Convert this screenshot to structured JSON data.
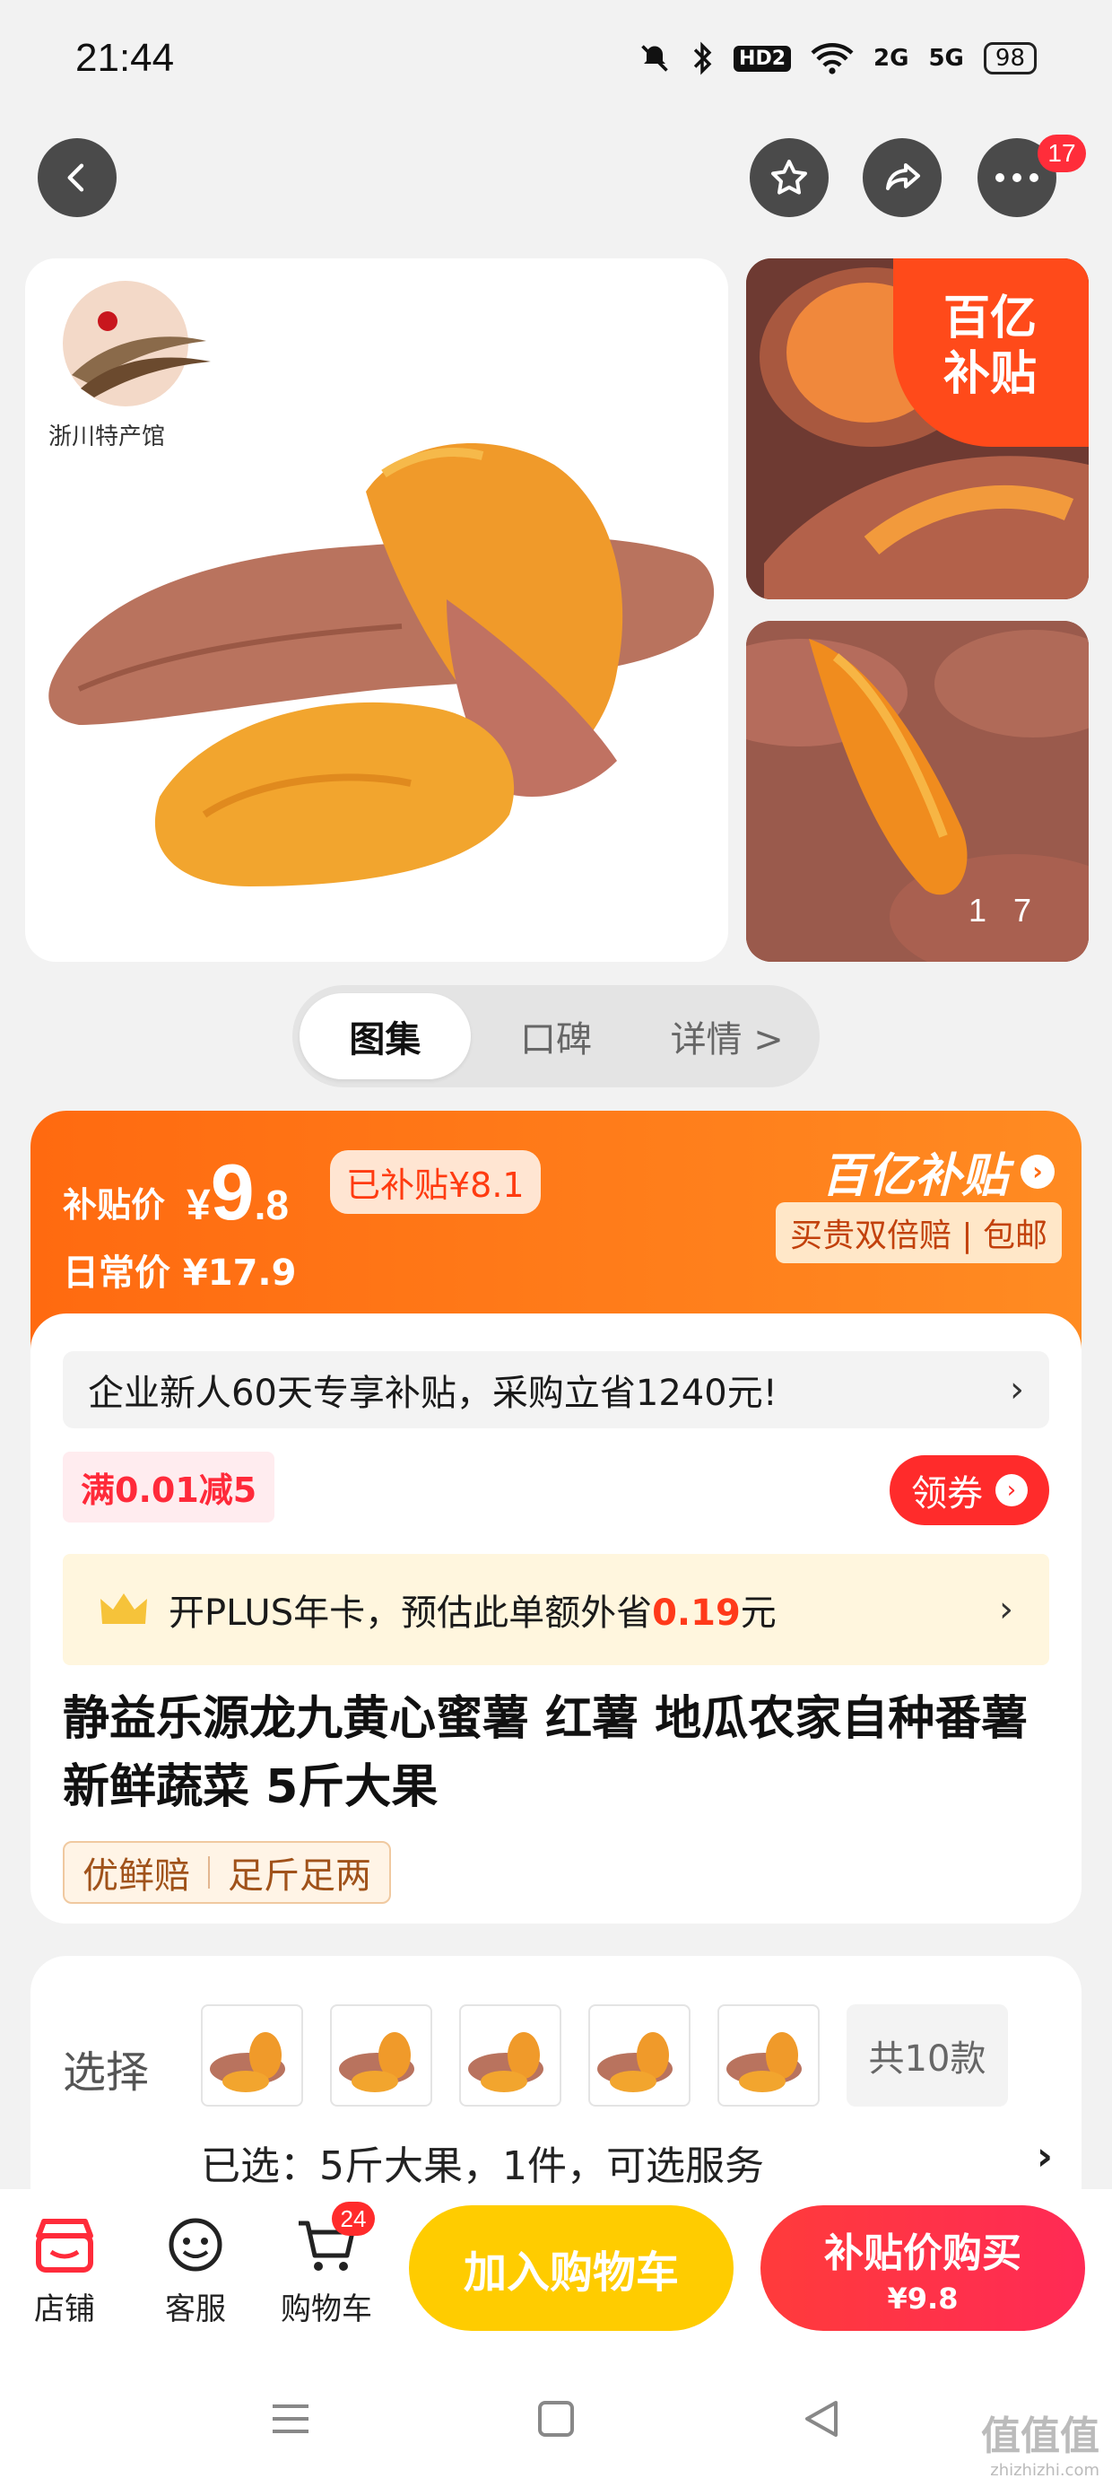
{
  "status_bar": {
    "time": "21:44",
    "hd": "HD2",
    "sig1": "2G",
    "sig2": "5G",
    "battery": "98"
  },
  "nav": {
    "cart_badge_count": "17"
  },
  "gallery": {
    "brand_name": "浙川特产馆",
    "subsidy_corner": [
      "百亿",
      "补贴"
    ],
    "counter": [
      "1",
      "7"
    ]
  },
  "tabs": [
    {
      "label": "图集",
      "active": true
    },
    {
      "label": "口碑",
      "active": false
    },
    {
      "label": "详情 >",
      "active": false
    }
  ],
  "price": {
    "label": "补贴价",
    "currency": "¥",
    "integer": "9",
    "decimal": ".8",
    "subsidized": "已补贴¥8.1",
    "daily": "日常价 ¥17.9",
    "brand": "百亿补贴",
    "slogan": "买贵双倍赔 | 包邮"
  },
  "info": {
    "notice": "企业新人60天专享补贴，采购立省1240元!",
    "coupon": "满0.01减5",
    "get_coupon": "领券",
    "plus_prefix": "开PLUS年卡，预估此单额外省",
    "plus_amount": "0.19",
    "plus_suffix": "元",
    "title": "静益乐源龙九黄心蜜薯 红薯 地瓜农家自种番薯 新鲜蔬菜 5斤大果",
    "tags": [
      "优鲜赔",
      "足斤足两"
    ]
  },
  "select": {
    "label": "选择",
    "variant_count": "共10款",
    "selected": "已选：5斤大果，1件，可选服务"
  },
  "bottom": {
    "shop": "店铺",
    "service": "客服",
    "cart": "购物车",
    "cart_count": "24",
    "add_cart": "加入购物车",
    "buy": "补贴价购买",
    "buy_price": "¥9.8"
  },
  "watermark": {
    "main": "值值值",
    "sub": "zhizhizhi.com"
  },
  "colors": {
    "accent_orange": "#ff6a10",
    "red": "#ff2b2b",
    "yellow": "#ffcc00"
  }
}
